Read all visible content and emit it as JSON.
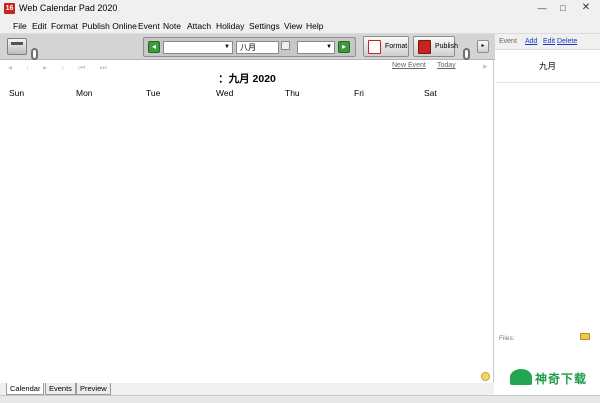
{
  "window": {
    "title": "Web Calendar Pad 2020",
    "app_icon_text": "16",
    "min_glyph": "—",
    "max_glyph": "□",
    "close_glyph": "✕"
  },
  "menu": [
    "File",
    "Edit",
    "Format",
    "Publish Online",
    "Event",
    "Note",
    "Attach",
    "Holiday",
    "Settings",
    "View",
    "Help"
  ],
  "toolbar": {
    "back_glyph": "◂",
    "forward_glyph": "▸",
    "year_combo_value": "",
    "month_combo_value": "八月",
    "view_combo_value": "",
    "format_label": "Format",
    "publish_label": "Publish",
    "more_glyph": "▸"
  },
  "calendar": {
    "nav_glyphs": "◂ ‹ ▸ › ⏮ ⏭",
    "new_event_link": "New Event",
    "today_link": "Today",
    "right_glyph": "▸",
    "title": "：九月 2020",
    "days": [
      "Sun",
      "Mon",
      "Tue",
      "Wed",
      "Thu",
      "Fri",
      "Sat"
    ]
  },
  "tabs": [
    "Calendar",
    "Events",
    "Preview"
  ],
  "side": {
    "heading": "Event",
    "links": [
      "Add",
      "Edit",
      "Delete"
    ],
    "month": "九月",
    "files_label": "Files:"
  },
  "watermark": {
    "text": "神奇下载"
  },
  "colors": {
    "accent_green": "#3e9a3b",
    "link_blue": "#1a37c6",
    "brand_red": "#c8231c"
  }
}
